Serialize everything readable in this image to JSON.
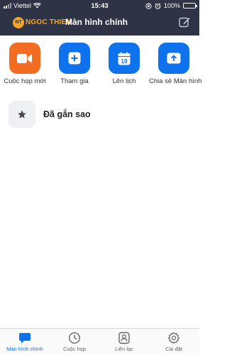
{
  "status_bar": {
    "carrier": "Viettel",
    "time": "15:43",
    "battery": "100%"
  },
  "header": {
    "logo_badge": "NT",
    "logo_text": "NGOC THIEN",
    "title": "Màn hình chính"
  },
  "actions": [
    {
      "label": "Cuộc họp mới",
      "icon": "video-camera-icon",
      "color": "#f26d21"
    },
    {
      "label": "Tham gia",
      "icon": "plus-icon",
      "color": "#0e72ed"
    },
    {
      "label": "Lên lịch",
      "icon": "calendar-icon",
      "color": "#0e72ed",
      "calendar_day": "19"
    },
    {
      "label": "Chia sẻ Màn hình",
      "icon": "share-screen-icon",
      "color": "#0e72ed"
    }
  ],
  "starred": {
    "label": "Đã gắn sao",
    "icon": "star-icon"
  },
  "tabbar": [
    {
      "label": "Màn hình chính",
      "icon": "chat-bubble-icon",
      "active": true
    },
    {
      "label": "Cuộc họp",
      "icon": "clock-icon",
      "active": false
    },
    {
      "label": "Liên lạc",
      "icon": "contact-icon",
      "active": false
    },
    {
      "label": "Cài đặt",
      "icon": "gear-icon",
      "active": false
    }
  ],
  "colors": {
    "header_bg": "#2e3346",
    "accent_blue": "#0e72ed",
    "accent_orange": "#f26d21"
  }
}
